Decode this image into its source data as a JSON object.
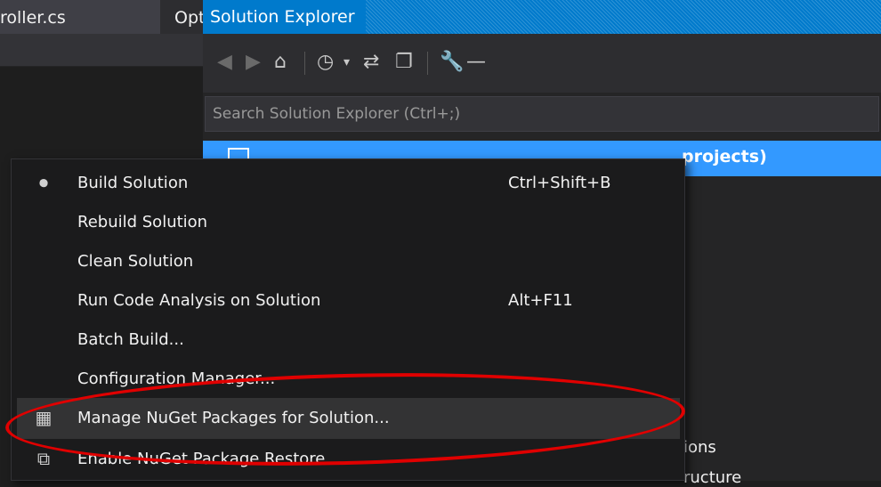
{
  "editor": {
    "tab_label": "roller.cs",
    "opt_label": "Opt"
  },
  "solution_explorer": {
    "title": "Solution Explorer",
    "toolbar_icons": [
      "back-icon",
      "forward-icon",
      "home-icon",
      "history-icon",
      "sync-icon",
      "collapse-all-icon",
      "properties-wrench-icon",
      "minus-icon"
    ],
    "search_placeholder": "Search Solution Explorer (Ctrl+;)",
    "selected_node_tail": "projects)",
    "tree_fragments": [
      "ions",
      "ructure"
    ]
  },
  "context_menu": {
    "items": [
      {
        "label": "Build Solution",
        "shortcut": "Ctrl+Shift+B",
        "icon": "build-icon"
      },
      {
        "label": "Rebuild Solution",
        "shortcut": ""
      },
      {
        "label": "Clean Solution",
        "shortcut": ""
      },
      {
        "label": "Run Code Analysis on Solution",
        "shortcut": "Alt+F11"
      },
      {
        "label": "Batch Build...",
        "shortcut": ""
      },
      {
        "label": "Configuration Manager...",
        "shortcut": ""
      },
      {
        "label": "Manage NuGet Packages for Solution...",
        "shortcut": "",
        "icon": "nuget-package-icon"
      },
      {
        "label": "Enable NuGet Package Restore",
        "shortcut": "",
        "icon": "package-restore-icon"
      }
    ],
    "highlighted_index": 6
  },
  "colors": {
    "accent": "#007acc",
    "selection": "#3399ff",
    "annotation_red": "#e00000"
  }
}
